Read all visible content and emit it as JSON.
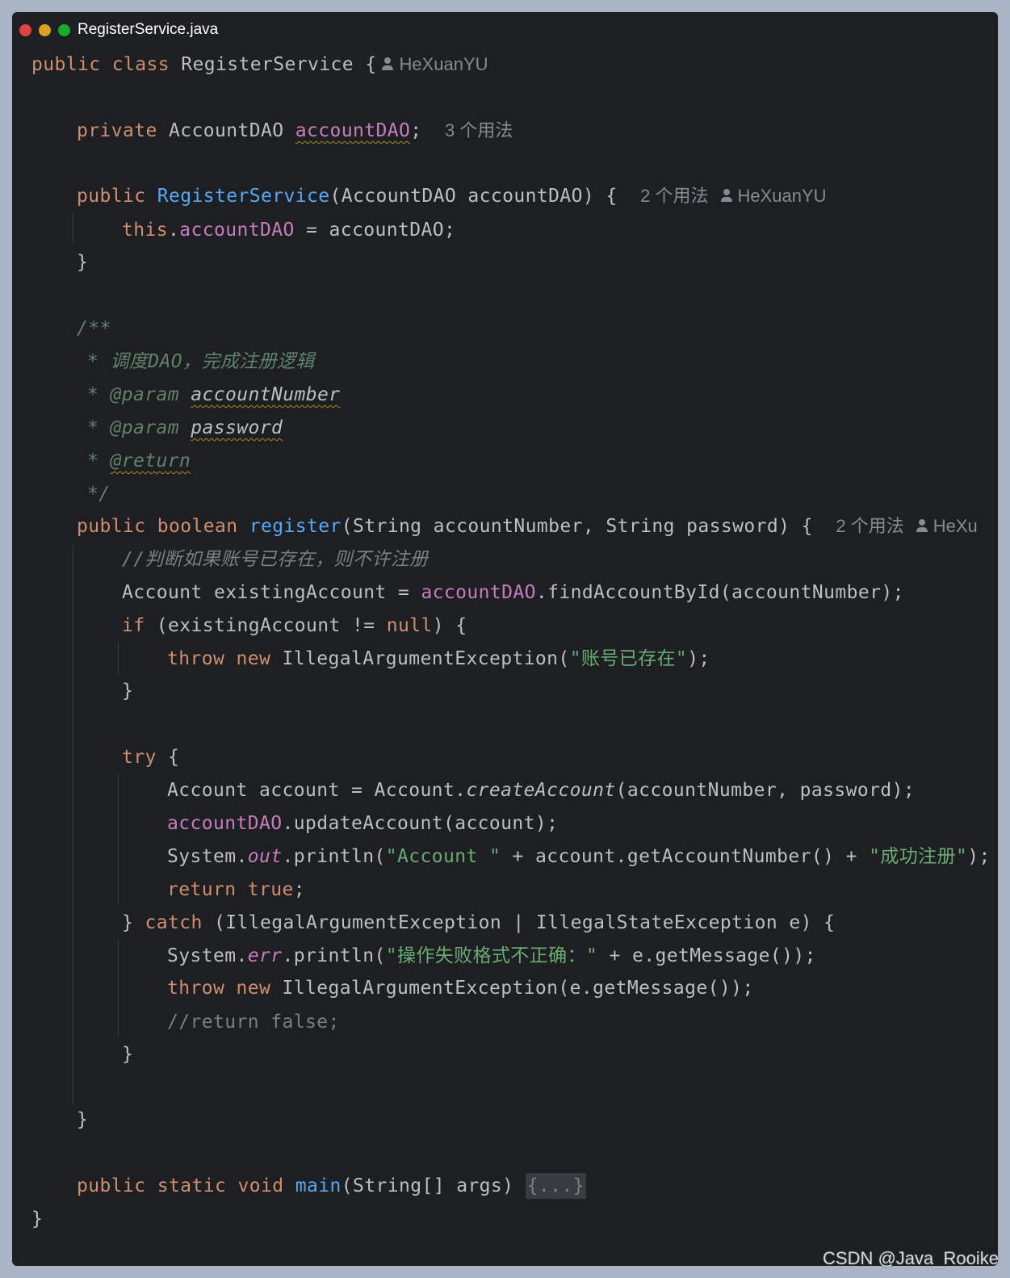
{
  "window": {
    "filename": "RegisterService.java"
  },
  "code": {
    "class_line": {
      "kw1": "public",
      "kw2": "class",
      "name": "RegisterService {",
      "author": "HeXuanYU"
    },
    "field_line": {
      "kw": "private",
      "type": "AccountDAO",
      "field": "accountDAO",
      "semi": ";",
      "usages": "3 个用法"
    },
    "ctor_line": {
      "kw": "public",
      "name": "RegisterService",
      "params": "(AccountDAO accountDAO) {",
      "usages": "2 个用法",
      "author": "HeXuanYU"
    },
    "ctor_body": {
      "kw": "this",
      "dot": ".",
      "field": "accountDAO",
      "rest": " = accountDAO;"
    },
    "close_brace": "}",
    "javadoc": {
      "open": "/**",
      "desc": "* 调度DAO，完成注册逻辑",
      "star": "* ",
      "param_tag": "@param",
      "param1": "accountNumber",
      "param2": "password",
      "return_tag": "@return",
      "close": "*/"
    },
    "register_line": {
      "kw1": "public",
      "kw2": "boolean",
      "name": "register",
      "params": "(String accountNumber, String password) {",
      "usages": "2 个用法",
      "author": "HeXu"
    },
    "comment1": "//判断如果账号已存在，则不许注册",
    "existing_line": {
      "pre": "Account existingAccount = ",
      "field": "accountDAO",
      "post": ".findAccountById(accountNumber);"
    },
    "if_line": {
      "kw": "if",
      "mid": " (existingAccount != ",
      "null": "null",
      "post": ") {"
    },
    "throw1": {
      "kw1": "throw",
      "kw2": "new",
      "pre": " IllegalArgumentException(",
      "str": "\"账号已存在\"",
      "post": ");"
    },
    "try_line": {
      "kw": "try",
      "post": " {"
    },
    "create_line": {
      "pre": "Account account = Account.",
      "method": "createAccount",
      "post": "(accountNumber, password);"
    },
    "update_line": {
      "field": "accountDAO",
      "post": ".updateAccount(account);"
    },
    "println_line": {
      "pre": "System.",
      "out": "out",
      "mid": ".println(",
      "str1": "\"Account \"",
      "mid2": " + account.getAccountNumber() + ",
      "str2": "\"成功注册\"",
      "post": ");"
    },
    "return_line": {
      "kw1": "return",
      "kw2": "true",
      "post": ";"
    },
    "catch_line": {
      "pre": "} ",
      "kw": "catch",
      "post": " (IllegalArgumentException | IllegalStateException e) {"
    },
    "err_line": {
      "pre": "System.",
      "err": "err",
      "mid": ".println(",
      "str": "\"操作失败格式不正确：\"",
      "post": " + e.getMessage());"
    },
    "throw2": {
      "kw1": "throw",
      "kw2": "new",
      "post": " IllegalArgumentException(e.getMessage());"
    },
    "comment2": "//return false;",
    "main_line": {
      "kw1": "public",
      "kw2": "static",
      "kw3": "void",
      "name": "main",
      "params": "(String[] args) ",
      "fold": "{...}"
    }
  },
  "watermark": "CSDN @Java_Rooike",
  "colors": {
    "background": "#1e1f22",
    "keyword": "#cf8e6d",
    "function": "#56a8f5",
    "field": "#c77dbb",
    "string": "#6aab73",
    "comment": "#7a7e85",
    "doc_comment": "#5f826b"
  }
}
